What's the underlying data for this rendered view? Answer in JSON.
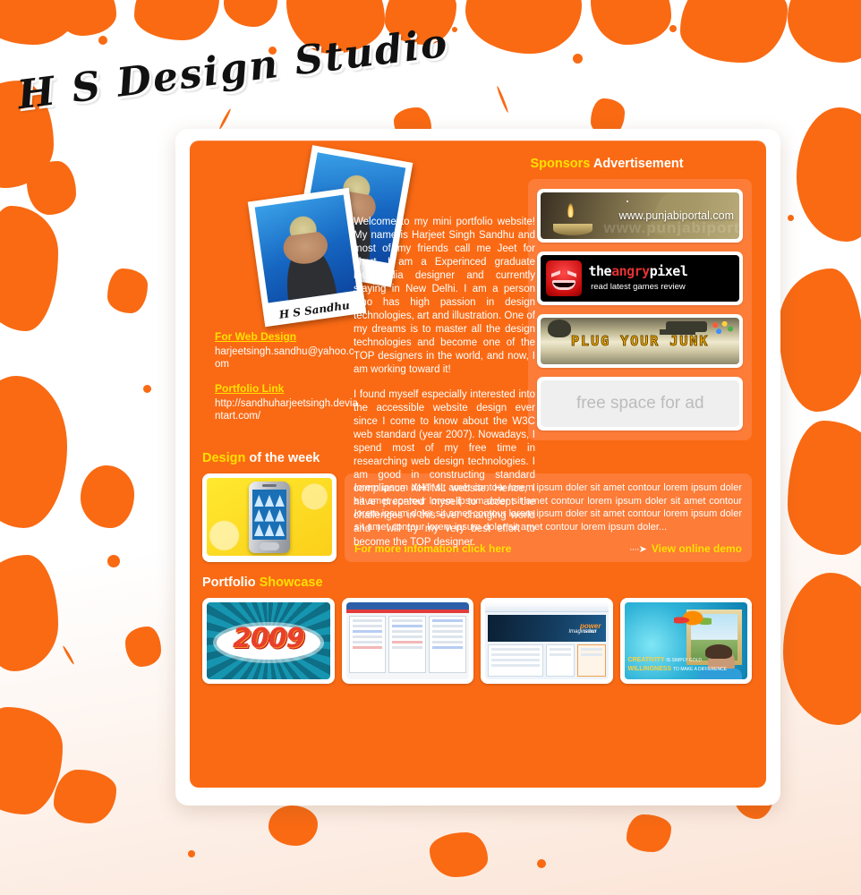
{
  "site": {
    "logo": "H S Design Studio"
  },
  "profile": {
    "photo_caption": "H S Sandhu",
    "intro_paragraph_1": "Welcome to my mini portfolio website! My name is Harjeet Singh Sandhu and most of my friends call me Jeet for short. I am a Experinced graduate multimedia designer and currently staying in New Delhi. I am a person who has high passion in design technologies, art and illustration. One of my dreams is to master all the design technologies and become one of the TOP designers in the world, and now, I am working toward it!",
    "intro_paragraph_2": "I found myself especially interested into the accessible website design ever since I come to know about the W3C web standard (year 2007). Nowadays, I spend most of my free time in researching web design technologies. I am good in constructing standard compliance XHTML website. Hence, I have prepared myself to accept the challenges in this ever changing world and I will try my very best effort to become the TOP designer."
  },
  "contact": {
    "web_design_label": "For Web Design",
    "email": "harjeetsingh.sandhu@yahoo.com",
    "portfolio_label": "Portfolio Link",
    "portfolio_url": "http://sandhuharjeetsingh.deviantart.com/"
  },
  "sponsors": {
    "heading_highlight": "Sponsors",
    "heading_rest": "Advertisement",
    "ads": [
      {
        "name": "punjabiportal",
        "url_text": "www.punjabiportal.com",
        "ghost_text": "www.punjabiportal.com"
      },
      {
        "name": "theangrypixel",
        "brand_part_1": "the",
        "brand_part_2": "angry",
        "brand_part_3": "pixel",
        "tagline": "read latest games review"
      },
      {
        "name": "plugyourjunk",
        "text": "PLUG YOUR JUNK"
      },
      {
        "name": "free-space",
        "text": "free space for ad"
      }
    ]
  },
  "design_of_week": {
    "heading_highlight": "Design",
    "heading_rest": "of the week",
    "thumb_alt": "pda-application-screenshot",
    "body_text": "lorem ipsum doler sit amet contour lorem ipsum doler sit amet contour lorem ipsum doler sit amet contour lorem ipsum doler sit amet contour lorem ipsum doler sit amet contour lorem ipsum doler sit amet contour lorem ipsum doler sit amet contour lorem ipsum doler sit amet contour lorem ipsum doler sit amet contour lorem ipsum doler...",
    "more_info_link": "For more infomation click here",
    "demo_link": "View online demo",
    "arrow": "····➤"
  },
  "portfolio": {
    "heading_first": "Portfolio",
    "heading_second": "Showcase",
    "items": [
      {
        "name": "2009-graffiti-artwork",
        "caption": "2009"
      },
      {
        "name": "form-website-mockup",
        "caption": ""
      },
      {
        "name": "imagination-website-mockup",
        "hero_line_1": "Imagination",
        "hero_line_2": "is our",
        "hero_line_3": "power"
      },
      {
        "name": "balloons-frame-artwork",
        "cap_1": "CREATIVITY",
        "cap_1_sub": "IS SIMPLY GOLD",
        "cap_2": "WILLINGNESS",
        "cap_2_sub": "TO MAKE A DIFFERENCE"
      }
    ]
  },
  "colors": {
    "primary_orange": "#fa6a14",
    "panel_orange": "#fc7c38",
    "accent_yellow": "#ffe000",
    "white": "#ffffff"
  }
}
